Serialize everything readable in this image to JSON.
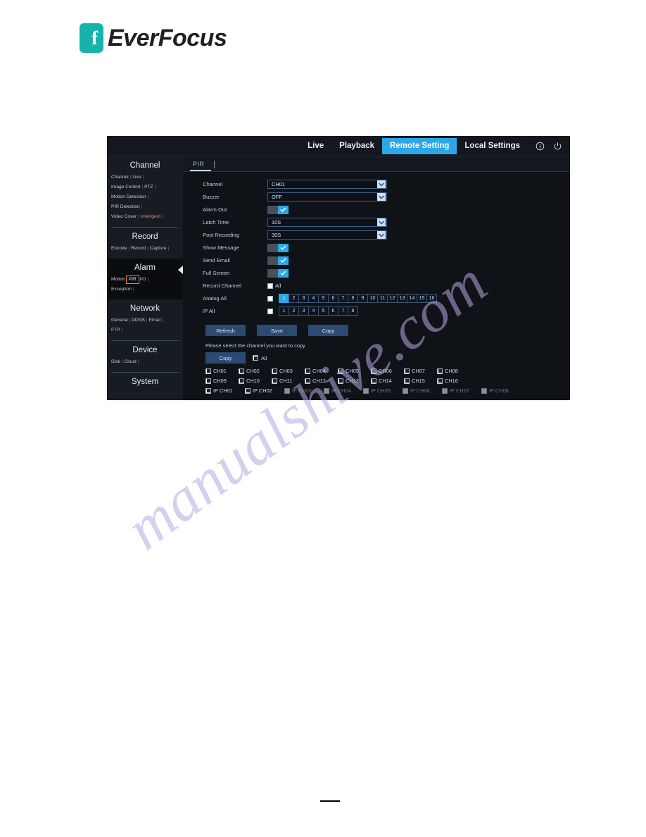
{
  "brand": {
    "name": "EverFocus",
    "mark_letter": "f"
  },
  "watermark": {
    "text": "manualshive.com"
  },
  "header": {
    "tabs": [
      {
        "label": "Live",
        "active": false
      },
      {
        "label": "Playback",
        "active": false
      },
      {
        "label": "Remote Setting",
        "active": true
      },
      {
        "label": "Local Settings",
        "active": false
      }
    ],
    "icons": [
      {
        "name": "info-icon"
      },
      {
        "name": "power-icon"
      }
    ],
    "accent_color": "#2ca8e8"
  },
  "sidebar": {
    "groups": [
      {
        "title": "Channel",
        "active": false,
        "links": [
          {
            "label": "Channel",
            "accent": false
          },
          {
            "label": "Live",
            "accent": false
          },
          {
            "label": "Image Control",
            "accent": false
          },
          {
            "label": "PTZ",
            "accent": false
          },
          {
            "label": "Motion Detection",
            "accent": false
          },
          {
            "label": "PIR Detection",
            "accent": false
          },
          {
            "label": "Video Cover",
            "accent": false
          },
          {
            "label": "Intelligent",
            "accent": true
          }
        ]
      },
      {
        "title": "Record",
        "active": false,
        "links": [
          {
            "label": "Encode",
            "accent": false
          },
          {
            "label": "Record",
            "accent": false
          },
          {
            "label": "Capture",
            "accent": false
          }
        ]
      },
      {
        "title": "Alarm",
        "active": true,
        "links": [
          {
            "label": "Motion",
            "accent": false
          },
          {
            "label": "PIR",
            "accent": false,
            "highlight": true
          },
          {
            "label": "I/O",
            "accent": false
          },
          {
            "label": "Exception",
            "accent": false
          }
        ]
      },
      {
        "title": "Network",
        "active": false,
        "links": [
          {
            "label": "General",
            "accent": false
          },
          {
            "label": "DDNS",
            "accent": false
          },
          {
            "label": "Email",
            "accent": false
          },
          {
            "label": "FTP",
            "accent": false
          }
        ]
      },
      {
        "title": "Device",
        "active": false,
        "links": [
          {
            "label": "Disk",
            "accent": false
          },
          {
            "label": "Cloud",
            "accent": false
          }
        ]
      },
      {
        "title": "System",
        "active": false,
        "links": []
      }
    ],
    "highlight_color": "#e8871e"
  },
  "content": {
    "tab": {
      "label": "PIR"
    },
    "fields": {
      "channel": {
        "label": "Channel",
        "value": "CH01"
      },
      "buzzer": {
        "label": "Buzzer",
        "value": "OFF"
      },
      "alarm_out": {
        "label": "Alarm Out",
        "on": true
      },
      "latch_time": {
        "label": "Latch Time",
        "value": "10S"
      },
      "post_recording": {
        "label": "Post Recording",
        "value": "30S"
      },
      "show_message": {
        "label": "Show Message",
        "on": true
      },
      "send_email": {
        "label": "Send Email",
        "on": true
      },
      "full_screen": {
        "label": "Full Screen",
        "on": true
      },
      "record_channel": {
        "label": "Record Channel",
        "all_label": "All",
        "all_checked": false
      },
      "analog_all": {
        "label": "Analog All",
        "checked": false,
        "channels": [
          "1",
          "2",
          "3",
          "4",
          "5",
          "6",
          "7",
          "8",
          "9",
          "10",
          "11",
          "12",
          "13",
          "14",
          "15",
          "16"
        ],
        "selected": [
          "1"
        ]
      },
      "ip_all": {
        "label": "IP All",
        "checked": false,
        "channels": [
          "1",
          "2",
          "3",
          "4",
          "5",
          "6",
          "7",
          "8"
        ],
        "selected": []
      }
    },
    "buttons": [
      {
        "label": "Refresh"
      },
      {
        "label": "Save"
      },
      {
        "label": "Copy"
      }
    ],
    "copy_section": {
      "hint": "Please select the channel you want to copy",
      "copy_label": "Copy",
      "all_label": "All",
      "all_checked": true,
      "analog_channels": [
        {
          "label": "CH01",
          "checked": true,
          "disabled": false
        },
        {
          "label": "CH02",
          "checked": true,
          "disabled": false
        },
        {
          "label": "CH03",
          "checked": true,
          "disabled": false
        },
        {
          "label": "CH04",
          "checked": true,
          "disabled": false
        },
        {
          "label": "CH05",
          "checked": true,
          "disabled": false
        },
        {
          "label": "CH06",
          "checked": true,
          "disabled": false
        },
        {
          "label": "CH07",
          "checked": true,
          "disabled": false
        },
        {
          "label": "CH08",
          "checked": true,
          "disabled": false
        },
        {
          "label": "CH09",
          "checked": true,
          "disabled": false
        },
        {
          "label": "CH10",
          "checked": true,
          "disabled": false
        },
        {
          "label": "CH11",
          "checked": true,
          "disabled": false
        },
        {
          "label": "CH12",
          "checked": true,
          "disabled": false
        },
        {
          "label": "CH13",
          "checked": true,
          "disabled": false
        },
        {
          "label": "CH14",
          "checked": true,
          "disabled": false
        },
        {
          "label": "CH15",
          "checked": true,
          "disabled": false
        },
        {
          "label": "CH16",
          "checked": true,
          "disabled": false
        }
      ],
      "ip_channels": [
        {
          "label": "IP CH01",
          "checked": true,
          "disabled": false
        },
        {
          "label": "IP CH02",
          "checked": true,
          "disabled": false
        },
        {
          "label": "IP CH03",
          "checked": false,
          "disabled": true
        },
        {
          "label": "IP CH04",
          "checked": false,
          "disabled": true
        },
        {
          "label": "IP CH05",
          "checked": false,
          "disabled": true
        },
        {
          "label": "IP CH06",
          "checked": false,
          "disabled": true
        },
        {
          "label": "IP CH07",
          "checked": false,
          "disabled": true
        },
        {
          "label": "IP CH08",
          "checked": false,
          "disabled": true
        }
      ]
    }
  },
  "footer": {
    "page_rule": ""
  }
}
